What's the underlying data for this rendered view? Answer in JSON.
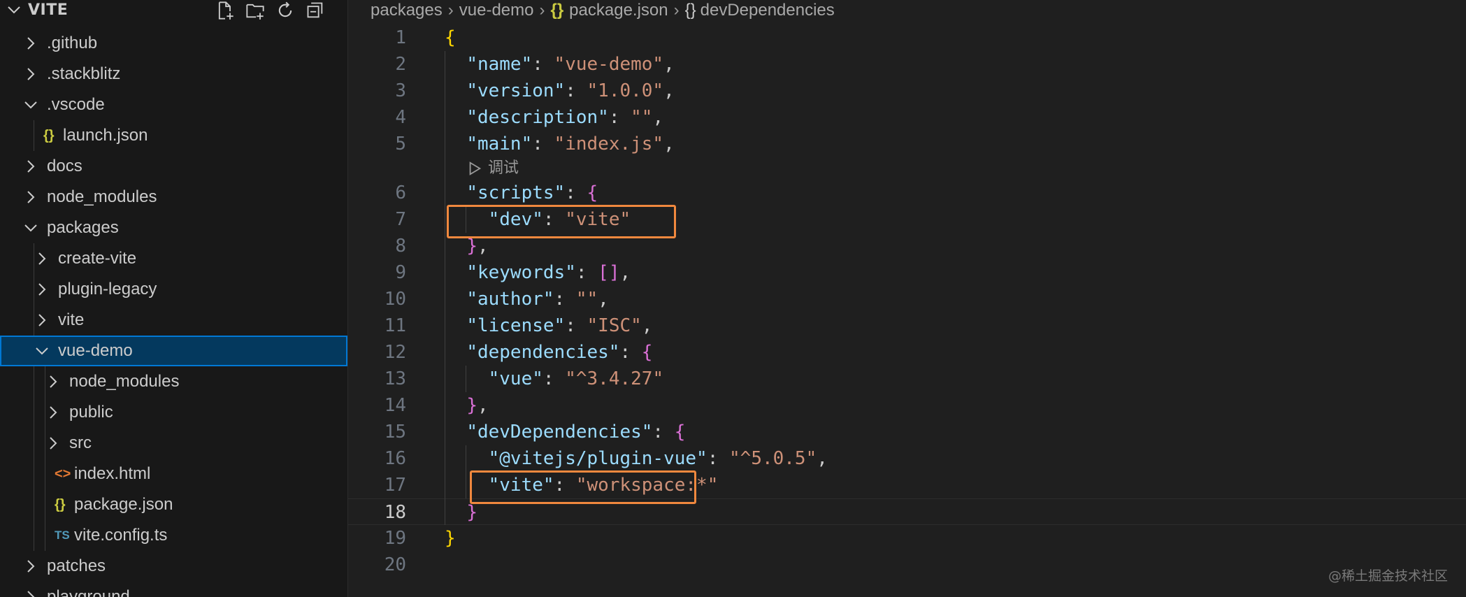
{
  "explorer": {
    "title": "VITE",
    "actions": [
      {
        "icon": "new-file-icon"
      },
      {
        "icon": "new-folder-icon"
      },
      {
        "icon": "refresh-icon"
      },
      {
        "icon": "collapse-all-icon"
      }
    ],
    "items": [
      {
        "label": ".github",
        "type": "folder",
        "open": false,
        "depth": 0
      },
      {
        "label": ".stackblitz",
        "type": "folder",
        "open": false,
        "depth": 0
      },
      {
        "label": ".vscode",
        "type": "folder",
        "open": true,
        "depth": 0
      },
      {
        "label": "launch.json",
        "type": "json",
        "depth": 1
      },
      {
        "label": "docs",
        "type": "folder",
        "open": false,
        "depth": 0
      },
      {
        "label": "node_modules",
        "type": "folder",
        "open": false,
        "depth": 0
      },
      {
        "label": "packages",
        "type": "folder",
        "open": true,
        "depth": 0
      },
      {
        "label": "create-vite",
        "type": "folder",
        "open": false,
        "depth": 1
      },
      {
        "label": "plugin-legacy",
        "type": "folder",
        "open": false,
        "depth": 1
      },
      {
        "label": "vite",
        "type": "folder",
        "open": false,
        "depth": 1
      },
      {
        "label": "vue-demo",
        "type": "folder",
        "open": true,
        "depth": 1,
        "selected": true
      },
      {
        "label": "node_modules",
        "type": "folder",
        "open": false,
        "depth": 2
      },
      {
        "label": "public",
        "type": "folder",
        "open": false,
        "depth": 2
      },
      {
        "label": "src",
        "type": "folder",
        "open": false,
        "depth": 2
      },
      {
        "label": "index.html",
        "type": "html",
        "depth": 2
      },
      {
        "label": "package.json",
        "type": "json",
        "depth": 2
      },
      {
        "label": "vite.config.ts",
        "type": "ts",
        "depth": 2
      },
      {
        "label": "patches",
        "type": "folder",
        "open": false,
        "depth": 0
      },
      {
        "label": "playground",
        "type": "folder",
        "open": false,
        "depth": 0
      }
    ],
    "icon_glyphs": {
      "json": "{}",
      "html": "<>",
      "ts": "TS"
    },
    "icon_colors": {
      "json": "#cbcb41",
      "html": "#e37933",
      "ts": "#519aba"
    }
  },
  "breadcrumb": {
    "items": [
      "packages",
      "vue-demo",
      "package.json",
      "devDependencies"
    ],
    "json_glyph": "{}",
    "obj_glyph": "{}"
  },
  "editor": {
    "active_line": 18,
    "codelens": {
      "after_line": 5,
      "label": "调试"
    },
    "lines": [
      {
        "n": 1,
        "tokens": [
          [
            "b1",
            "{"
          ]
        ]
      },
      {
        "n": 2,
        "tokens": [
          [
            "p",
            "  "
          ],
          [
            "k",
            "\"name\""
          ],
          [
            "p",
            ": "
          ],
          [
            "s",
            "\"vue-demo\""
          ],
          [
            "p",
            ","
          ]
        ]
      },
      {
        "n": 3,
        "tokens": [
          [
            "p",
            "  "
          ],
          [
            "k",
            "\"version\""
          ],
          [
            "p",
            ": "
          ],
          [
            "s",
            "\"1.0.0\""
          ],
          [
            "p",
            ","
          ]
        ]
      },
      {
        "n": 4,
        "tokens": [
          [
            "p",
            "  "
          ],
          [
            "k",
            "\"description\""
          ],
          [
            "p",
            ": "
          ],
          [
            "s",
            "\"\""
          ],
          [
            "p",
            ","
          ]
        ]
      },
      {
        "n": 5,
        "tokens": [
          [
            "p",
            "  "
          ],
          [
            "k",
            "\"main\""
          ],
          [
            "p",
            ": "
          ],
          [
            "s",
            "\"index.js\""
          ],
          [
            "p",
            ","
          ]
        ]
      },
      {
        "n": 6,
        "tokens": [
          [
            "p",
            "  "
          ],
          [
            "k",
            "\"scripts\""
          ],
          [
            "p",
            ": "
          ],
          [
            "b2",
            "{"
          ]
        ]
      },
      {
        "n": 7,
        "tokens": [
          [
            "p",
            "    "
          ],
          [
            "k",
            "\"dev\""
          ],
          [
            "p",
            ": "
          ],
          [
            "s",
            "\"vite\""
          ]
        ]
      },
      {
        "n": 8,
        "tokens": [
          [
            "p",
            "  "
          ],
          [
            "b2",
            "}"
          ],
          [
            "p",
            ","
          ]
        ]
      },
      {
        "n": 9,
        "tokens": [
          [
            "p",
            "  "
          ],
          [
            "k",
            "\"keywords\""
          ],
          [
            "p",
            ": "
          ],
          [
            "b2",
            "[]"
          ],
          [
            "p",
            ","
          ]
        ]
      },
      {
        "n": 10,
        "tokens": [
          [
            "p",
            "  "
          ],
          [
            "k",
            "\"author\""
          ],
          [
            "p",
            ": "
          ],
          [
            "s",
            "\"\""
          ],
          [
            "p",
            ","
          ]
        ]
      },
      {
        "n": 11,
        "tokens": [
          [
            "p",
            "  "
          ],
          [
            "k",
            "\"license\""
          ],
          [
            "p",
            ": "
          ],
          [
            "s",
            "\"ISC\""
          ],
          [
            "p",
            ","
          ]
        ]
      },
      {
        "n": 12,
        "tokens": [
          [
            "p",
            "  "
          ],
          [
            "k",
            "\"dependencies\""
          ],
          [
            "p",
            ": "
          ],
          [
            "b2",
            "{"
          ]
        ]
      },
      {
        "n": 13,
        "tokens": [
          [
            "p",
            "    "
          ],
          [
            "k",
            "\"vue\""
          ],
          [
            "p",
            ": "
          ],
          [
            "s",
            "\"^3.4.27\""
          ]
        ]
      },
      {
        "n": 14,
        "tokens": [
          [
            "p",
            "  "
          ],
          [
            "b2",
            "}"
          ],
          [
            "p",
            ","
          ]
        ]
      },
      {
        "n": 15,
        "tokens": [
          [
            "p",
            "  "
          ],
          [
            "k",
            "\"devDependencies\""
          ],
          [
            "p",
            ": "
          ],
          [
            "b2",
            "{"
          ]
        ]
      },
      {
        "n": 16,
        "tokens": [
          [
            "p",
            "    "
          ],
          [
            "k",
            "\"@vitejs/plugin-vue\""
          ],
          [
            "p",
            ": "
          ],
          [
            "s",
            "\"^5.0.5\""
          ],
          [
            "p",
            ","
          ]
        ]
      },
      {
        "n": 17,
        "tokens": [
          [
            "p",
            "    "
          ],
          [
            "k",
            "\"vite\""
          ],
          [
            "p",
            ": "
          ],
          [
            "s",
            "\"workspace:*\""
          ]
        ]
      },
      {
        "n": 18,
        "tokens": [
          [
            "p",
            "  "
          ],
          [
            "b2",
            "}"
          ]
        ]
      },
      {
        "n": 19,
        "tokens": [
          [
            "b1",
            "}"
          ]
        ]
      },
      {
        "n": 20,
        "tokens": []
      }
    ],
    "highlight_color": "#f0883e"
  },
  "watermark": "@稀土掘金技术社区"
}
